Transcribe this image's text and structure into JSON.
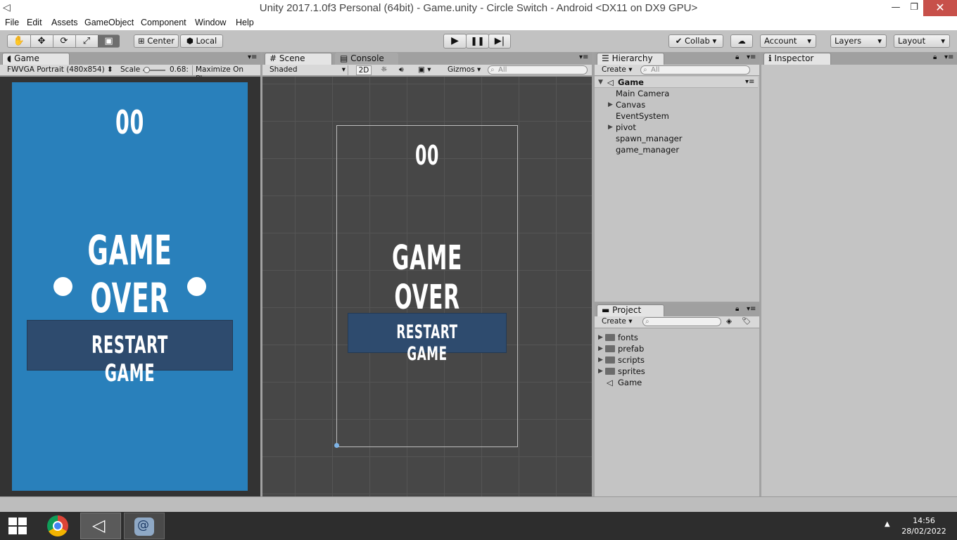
{
  "window": {
    "title": "Unity 2017.1.0f3 Personal (64bit) - Game.unity - Circle Switch - Android <DX11 on DX9 GPU>"
  },
  "menu": [
    "File",
    "Edit",
    "Assets",
    "GameObject",
    "Component",
    "Window",
    "Help"
  ],
  "toolbar": {
    "pivot_mode": "Center",
    "pivot_space": "Local",
    "collab": "Collab",
    "account": "Account",
    "layers": "Layers",
    "layout": "Layout"
  },
  "game_view": {
    "tab": "Game",
    "resolution": "FWVGA Portrait (480x854)",
    "scale_label": "Scale",
    "scale_value": "0.68:",
    "maximize": "Maximize On Play",
    "score": "00",
    "game_over": "GAME OVER",
    "restart": "RESTART GAME",
    "colors": {
      "background": "#2980bb",
      "button": "#2e4b6e"
    }
  },
  "scene_view": {
    "tab": "Scene",
    "console_tab": "Console",
    "shading": "Shaded",
    "mode_2d": "2D",
    "gizmos": "Gizmos",
    "search_placeholder": "All",
    "score": "00",
    "game_over": "GAME OVER",
    "restart": "RESTART GAME"
  },
  "hierarchy": {
    "tab": "Hierarchy",
    "create": "Create",
    "search_placeholder": "All",
    "scene": "Game",
    "items": [
      {
        "label": "Main Camera",
        "expandable": false
      },
      {
        "label": "Canvas",
        "expandable": true
      },
      {
        "label": "EventSystem",
        "expandable": false
      },
      {
        "label": "pivot",
        "expandable": true
      },
      {
        "label": "spawn_manager",
        "expandable": false
      },
      {
        "label": "game_manager",
        "expandable": false
      }
    ]
  },
  "project": {
    "tab": "Project",
    "create": "Create",
    "items": [
      {
        "label": "fonts",
        "icon": "folder"
      },
      {
        "label": "prefab",
        "icon": "folder"
      },
      {
        "label": "scripts",
        "icon": "folder"
      },
      {
        "label": "sprites",
        "icon": "folder"
      },
      {
        "label": "Game",
        "icon": "unity-scene"
      }
    ]
  },
  "inspector": {
    "tab": "Inspector"
  },
  "taskbar": {
    "time": "14:56",
    "date": "28/02/2022"
  }
}
